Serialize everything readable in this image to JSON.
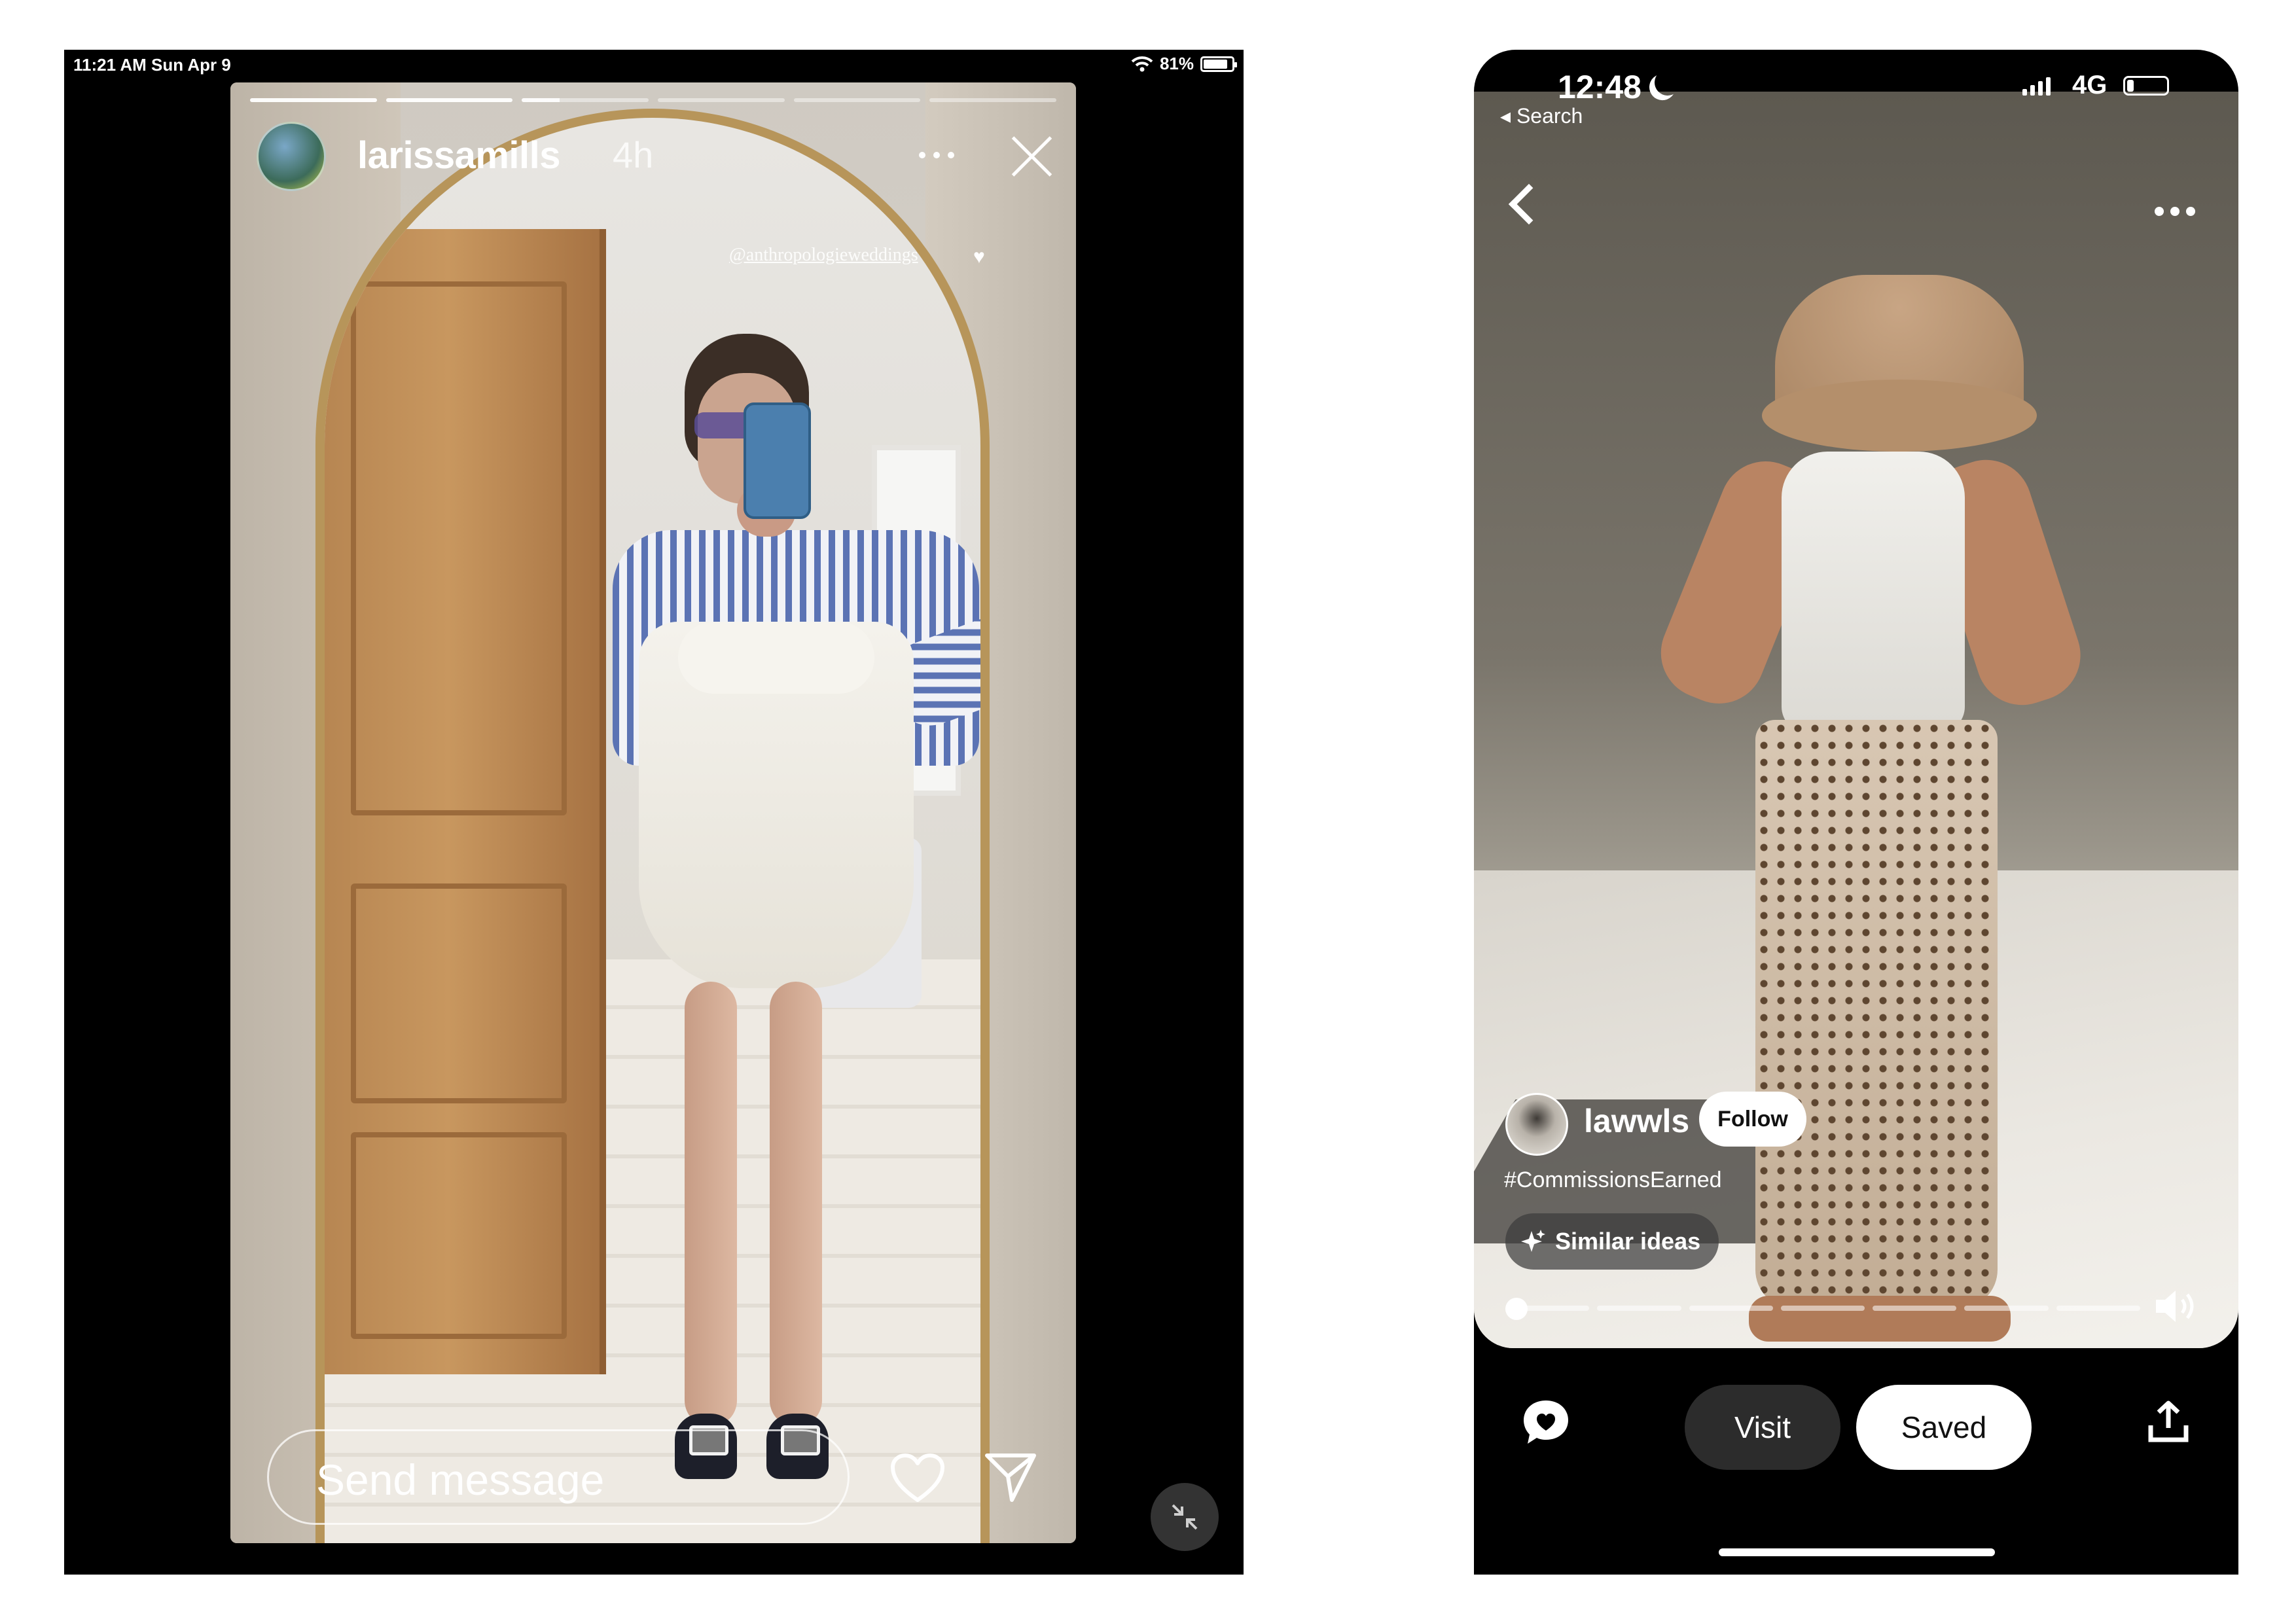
{
  "instagram": {
    "status_bar": {
      "time_date": "11:21 AM  Sun Apr 9",
      "battery": "81%"
    },
    "story": {
      "username": "larissamills",
      "time": "4h",
      "tag": "@anthropologieweddings",
      "progress_segments": 6,
      "active_segment": 3,
      "message_placeholder": "Send message"
    },
    "icons": [
      "wifi-icon",
      "battery-icon",
      "more-icon",
      "close-icon",
      "heart-icon",
      "send-icon",
      "collapse-icon"
    ]
  },
  "pinterest": {
    "status_bar": {
      "time": "12:48",
      "back_label": "◂ Search",
      "network": "4G"
    },
    "pin": {
      "username": "lawwls",
      "follow_label": "Follow",
      "hashtag": "#CommissionsEarned",
      "similar_label": "Similar ideas",
      "video_segments": 7,
      "video_progress": 0.0
    },
    "bottom_bar": {
      "visit_label": "Visit",
      "saved_label": "Saved"
    },
    "colors": {
      "saved_bg": "#ffffff",
      "visit_bg": "#2c2c2c",
      "bg": "#000000"
    }
  }
}
